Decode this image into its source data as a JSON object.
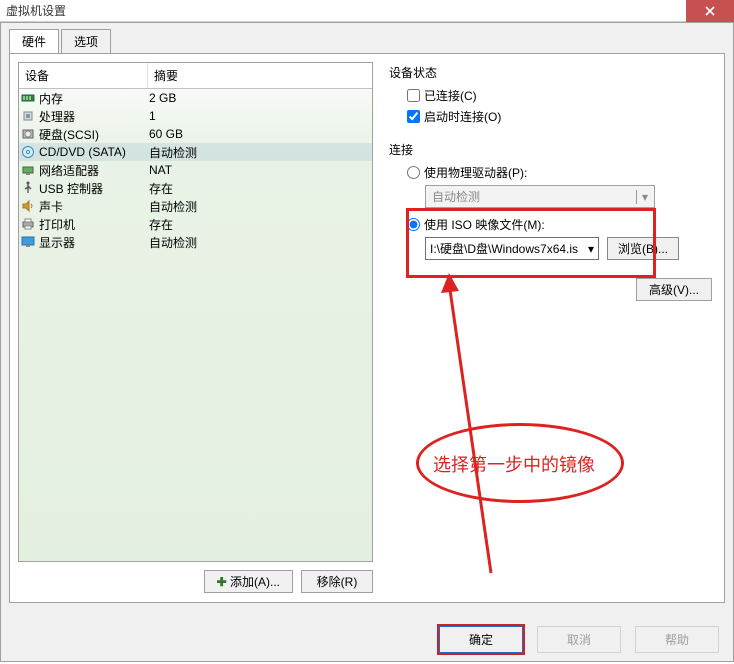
{
  "title": "虚拟机设置",
  "tabs": {
    "hardware": "硬件",
    "options": "选项"
  },
  "table": {
    "headers": {
      "device": "设备",
      "summary": "摘要"
    },
    "rows": [
      {
        "icon": "memory-icon",
        "name": "内存",
        "summary": "2 GB"
      },
      {
        "icon": "cpu-icon",
        "name": "处理器",
        "summary": "1"
      },
      {
        "icon": "disk-icon",
        "name": "硬盘(SCSI)",
        "summary": "60 GB"
      },
      {
        "icon": "cd-icon",
        "name": "CD/DVD (SATA)",
        "summary": "自动检测"
      },
      {
        "icon": "net-icon",
        "name": "网络适配器",
        "summary": "NAT"
      },
      {
        "icon": "usb-icon",
        "name": "USB 控制器",
        "summary": "存在"
      },
      {
        "icon": "sound-icon",
        "name": "声卡",
        "summary": "自动检测"
      },
      {
        "icon": "printer-icon",
        "name": "打印机",
        "summary": "存在"
      },
      {
        "icon": "display-icon",
        "name": "显示器",
        "summary": "自动检测"
      }
    ]
  },
  "buttons": {
    "add": "添加(A)...",
    "remove": "移除(R)",
    "browse": "浏览(B)...",
    "advanced": "高级(V)...",
    "ok": "确定",
    "cancel": "取消",
    "help": "帮助"
  },
  "deviceStatus": {
    "label": "设备状态",
    "connected": "已连接(C)",
    "connectAtPowerOn": "启动时连接(O)"
  },
  "connection": {
    "label": "连接",
    "usePhysical": "使用物理驱动器(P):",
    "physicalValue": "自动检测",
    "useIso": "使用 ISO 映像文件(M):",
    "isoPath": "I:\\硬盘\\D盘\\Windows7x64.is"
  },
  "annotation": {
    "text": "选择第一步中的镜像"
  },
  "checkedConnectAtPowerOn": true,
  "checkedConnected": false,
  "radioPhysical": false,
  "radioIso": true
}
